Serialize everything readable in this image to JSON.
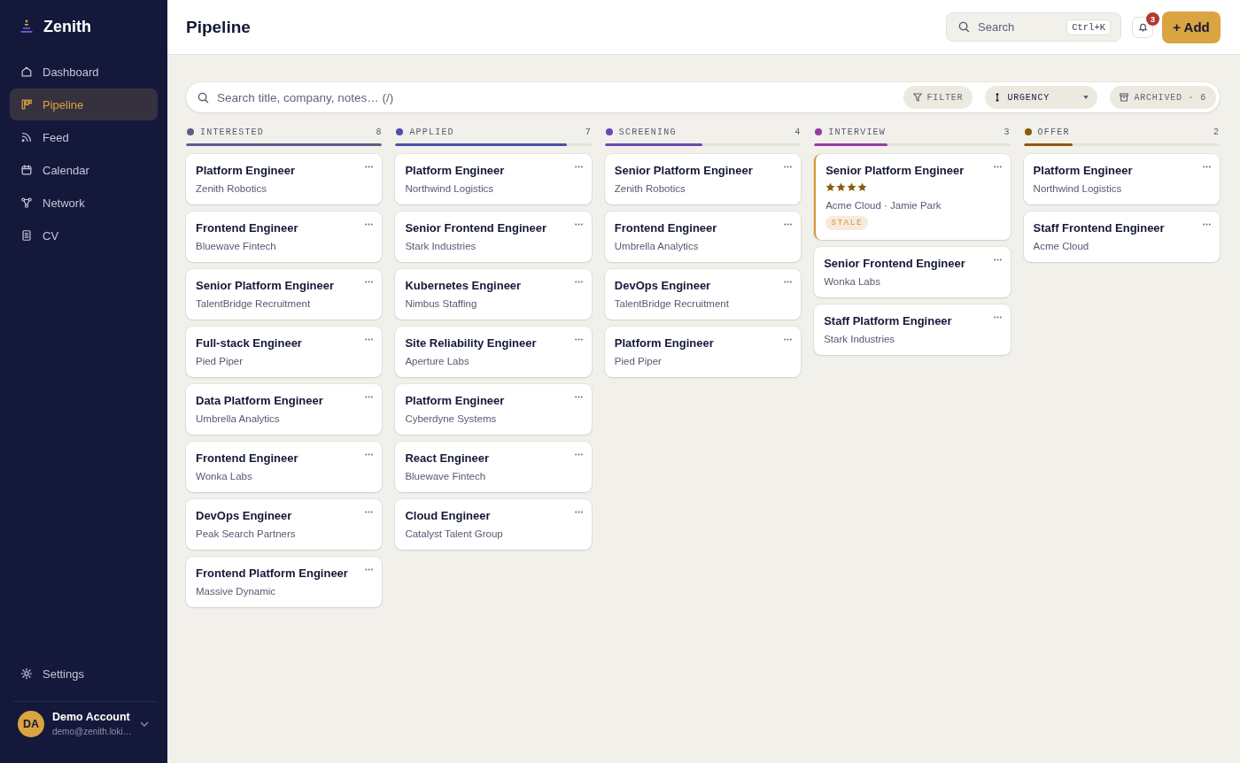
{
  "sidebar": {
    "brand": "Zenith",
    "nav": [
      {
        "label": "Dashboard",
        "selected": false
      },
      {
        "label": "Pipeline",
        "selected": true
      },
      {
        "label": "Feed",
        "selected": false
      },
      {
        "label": "Calendar",
        "selected": false
      },
      {
        "label": "Network",
        "selected": false
      },
      {
        "label": "CV",
        "selected": false
      }
    ],
    "settings": "Settings",
    "account": {
      "initials": "DA",
      "name": "Demo Account",
      "email": "demo@zenith.loki…"
    }
  },
  "header": {
    "title": "Pipeline",
    "search": {
      "placeholder": "Search",
      "shortcut": "Ctrl+K"
    },
    "notifications": "3",
    "add_button": "+ Add"
  },
  "board_toolbar": {
    "search": {
      "placeholder": "Search title, company, notes… (/)"
    },
    "filter": "FILTER",
    "sort": "URGENCY",
    "archived": "ARCHIVED · 6"
  },
  "columns": [
    {
      "name": "INTERESTED",
      "count": "8",
      "color": "#5a5e8c",
      "level": 1,
      "cards": [
        {
          "title": "Platform Engineer",
          "company": "Zenith Robotics",
          "flagged": false
        },
        {
          "title": "Frontend Engineer",
          "company": "Bluewave Fintech",
          "flagged": false
        },
        {
          "title": "Senior Platform Engineer",
          "company": "TalentBridge Recruitment",
          "flagged": false
        },
        {
          "title": "Full-stack Engineer",
          "company": "Pied Piper",
          "flagged": false
        },
        {
          "title": "Data Platform Engineer",
          "company": "Umbrella Analytics",
          "flagged": false
        },
        {
          "title": "Frontend Engineer",
          "company": "Wonka Labs",
          "flagged": false
        },
        {
          "title": "DevOps Engineer",
          "company": "Peak Search Partners",
          "flagged": false
        },
        {
          "title": "Frontend Platform Engineer",
          "company": "Massive Dynamic",
          "flagged": false
        }
      ]
    },
    {
      "name": "APPLIED",
      "count": "7",
      "color": "#4a4fae",
      "level": 0.875,
      "cards": [
        {
          "title": "Platform Engineer",
          "company": "Northwind Logistics",
          "flagged": false
        },
        {
          "title": "Senior Frontend Engineer",
          "company": "Stark Industries",
          "flagged": false
        },
        {
          "title": "Kubernetes Engineer",
          "company": "Nimbus Staffing",
          "flagged": false
        },
        {
          "title": "Site Reliability Engineer",
          "company": "Aperture Labs",
          "flagged": false
        },
        {
          "title": "Platform Engineer",
          "company": "Cyberdyne Systems",
          "flagged": false
        },
        {
          "title": "React Engineer",
          "company": "Bluewave Fintech",
          "flagged": false
        },
        {
          "title": "Cloud Engineer",
          "company": "Catalyst Talent Group",
          "flagged": false
        }
      ]
    },
    {
      "name": "SCREENING",
      "count": "4",
      "color": "#6a48b2",
      "level": 0.5,
      "cards": [
        {
          "title": "Senior Platform Engineer",
          "company": "Zenith Robotics",
          "flagged": false
        },
        {
          "title": "Frontend Engineer",
          "company": "Umbrella Analytics",
          "flagged": false
        },
        {
          "title": "DevOps Engineer",
          "company": "TalentBridge Recruitment",
          "flagged": false
        },
        {
          "title": "Platform Engineer",
          "company": "Pied Piper",
          "flagged": false
        }
      ]
    },
    {
      "name": "INTERVIEW",
      "count": "3",
      "color": "#953ca6",
      "level": 0.375,
      "cards": [
        {
          "title": "Senior Platform Engineer",
          "stars": 4,
          "company": "Acme Cloud · Jamie Park",
          "badge": "STALE",
          "flagged": true
        },
        {
          "title": "Senior Frontend Engineer",
          "company": "Wonka Labs",
          "flagged": false
        },
        {
          "title": "Staff Platform Engineer",
          "company": "Stark Industries",
          "flagged": false
        }
      ]
    },
    {
      "name": "OFFER",
      "count": "2",
      "color": "#8a5c10",
      "level": 0.25,
      "cards": [
        {
          "title": "Platform Engineer",
          "company": "Northwind Logistics",
          "flagged": false
        },
        {
          "title": "Staff Frontend Engineer",
          "company": "Acme Cloud",
          "flagged": false
        }
      ]
    }
  ]
}
